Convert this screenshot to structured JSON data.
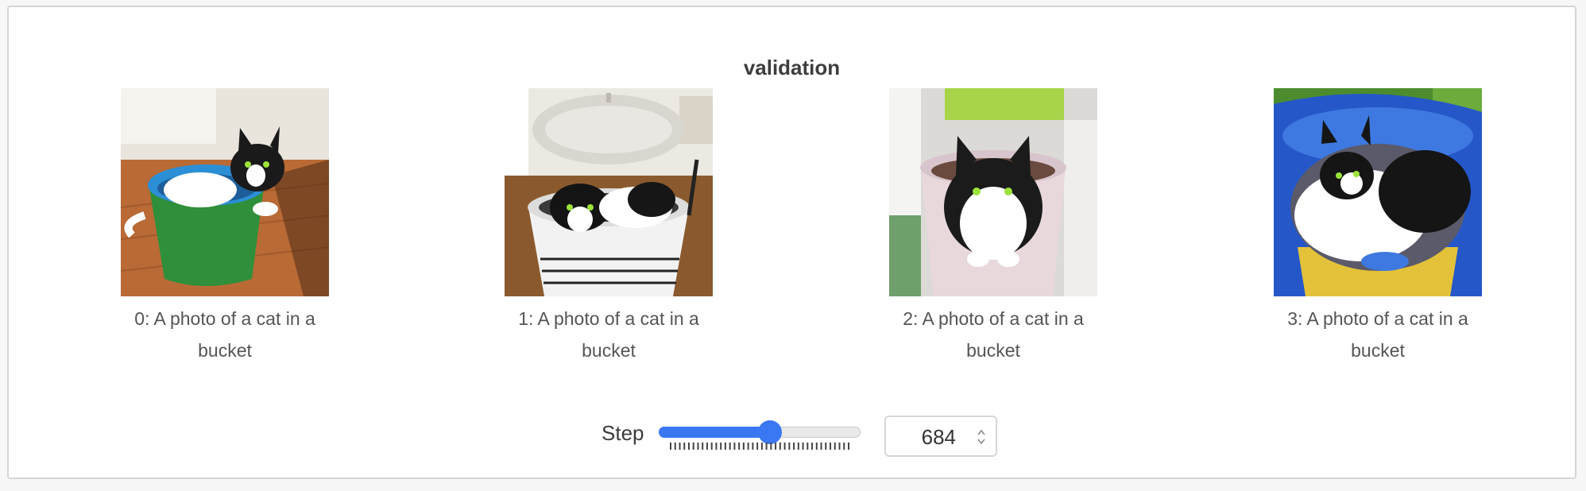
{
  "panel": {
    "title": "validation"
  },
  "images": [
    {
      "caption": "0: A photo of a cat in a bucket",
      "bucket_color": "#2f8f3a",
      "rim_color": "#2c8fd6"
    },
    {
      "caption": "1: A photo of a cat in a bucket",
      "bucket_color": "#f2f2f2",
      "rim_color": "#d9d9d9"
    },
    {
      "caption": "2: A photo of a cat in a bucket",
      "bucket_color": "#e8d8dc",
      "rim_color": "#d8c4cc"
    },
    {
      "caption": "3: A photo of a cat in a bucket",
      "bucket_color": "#2557c9",
      "rim_color": "#3d79e0"
    }
  ],
  "step_control": {
    "label": "Step",
    "value": "684",
    "slider_fraction": 0.55,
    "accent_color": "#3a77f3"
  }
}
